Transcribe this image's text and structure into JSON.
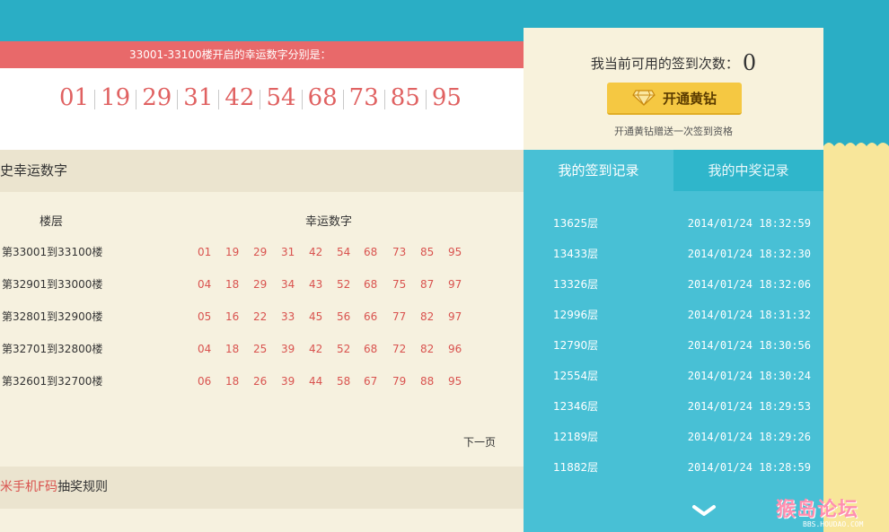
{
  "lucky": {
    "banner": "33001-33100楼开启的幸运数字分别是：",
    "numbers": [
      "01",
      "19",
      "29",
      "31",
      "42",
      "54",
      "68",
      "73",
      "85",
      "95"
    ]
  },
  "history": {
    "title": "史幸运数字",
    "col_floor": "楼层",
    "col_numbers": "幸运数字",
    "rows": [
      {
        "floor": "第33001到33100楼",
        "nums": [
          "01",
          "19",
          "29",
          "31",
          "42",
          "54",
          "68",
          "73",
          "85",
          "95"
        ]
      },
      {
        "floor": "第32901到33000楼",
        "nums": [
          "04",
          "18",
          "29",
          "34",
          "43",
          "52",
          "68",
          "75",
          "87",
          "97"
        ]
      },
      {
        "floor": "第32801到32900楼",
        "nums": [
          "05",
          "16",
          "22",
          "33",
          "45",
          "56",
          "66",
          "77",
          "82",
          "97"
        ]
      },
      {
        "floor": "第32701到32800楼",
        "nums": [
          "04",
          "18",
          "25",
          "39",
          "42",
          "52",
          "68",
          "72",
          "82",
          "96"
        ]
      },
      {
        "floor": "第32601到32700楼",
        "nums": [
          "06",
          "18",
          "26",
          "39",
          "44",
          "58",
          "67",
          "79",
          "88",
          "95"
        ]
      }
    ],
    "next_page": "下一页"
  },
  "rules": {
    "prefix": "米手机F码",
    "suffix": "抽奖规则"
  },
  "signin": {
    "label": "我当前可用的签到次数：",
    "count": "0",
    "vip_button": "开通黄钻",
    "vip_note": "开通黄钻赠送一次签到资格"
  },
  "tabs": {
    "my_signin": "我的签到记录",
    "my_prize": "我的中奖记录"
  },
  "records": [
    {
      "floor": "13625层",
      "time": "2014/01/24 18:32:59"
    },
    {
      "floor": "13433层",
      "time": "2014/01/24 18:32:30"
    },
    {
      "floor": "13326层",
      "time": "2014/01/24 18:32:06"
    },
    {
      "floor": "12996层",
      "time": "2014/01/24 18:31:32"
    },
    {
      "floor": "12790层",
      "time": "2014/01/24 18:30:56"
    },
    {
      "floor": "12554层",
      "time": "2014/01/24 18:30:24"
    },
    {
      "floor": "12346层",
      "time": "2014/01/24 18:29:53"
    },
    {
      "floor": "12189层",
      "time": "2014/01/24 18:29:26"
    },
    {
      "floor": "11882层",
      "time": "2014/01/24 18:28:59"
    }
  ],
  "watermark": {
    "text": "猴岛论坛",
    "sub": "BBS.HOUDAO.COM"
  },
  "icons": {
    "gem": "diamond-icon",
    "scroll": "chevron-down-icon"
  },
  "colors": {
    "accent_red": "#e8696a",
    "teal": "#2aaec5",
    "tab_active": "#48c0d5",
    "gold": "#f5c842",
    "cream": "#f6f1df"
  }
}
